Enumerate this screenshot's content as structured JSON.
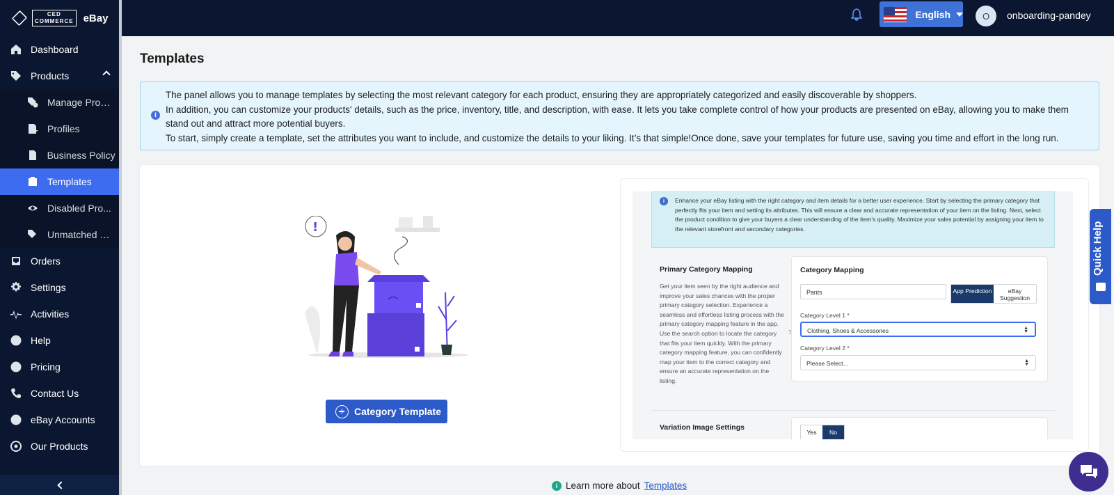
{
  "brand": {
    "logo_line1": "CED",
    "logo_line2": "COMMERCE",
    "product": "eBay"
  },
  "sidebar": {
    "items": [
      {
        "label": "Dashboard",
        "icon": "home-icon"
      },
      {
        "label": "Products",
        "icon": "tag-icon"
      },
      {
        "label": "Manage Prod...",
        "icon": "gear-tag-icon"
      },
      {
        "label": "Profiles",
        "icon": "profile-doc-icon"
      },
      {
        "label": "Business Policy",
        "icon": "document-icon"
      },
      {
        "label": "Templates",
        "icon": "template-icon"
      },
      {
        "label": "Disabled Pro...",
        "icon": "eye-off-icon"
      },
      {
        "label": "Unmatched Pr...",
        "icon": "tag-x-icon"
      },
      {
        "label": "Orders",
        "icon": "inbox-icon"
      },
      {
        "label": "Settings",
        "icon": "gear-icon"
      },
      {
        "label": "Activities",
        "icon": "activity-icon"
      },
      {
        "label": "Help",
        "icon": "help-icon"
      },
      {
        "label": "Pricing",
        "icon": "dollar-icon"
      },
      {
        "label": "Contact Us",
        "icon": "phone-icon"
      },
      {
        "label": "eBay Accounts",
        "icon": "user-icon"
      },
      {
        "label": "Our Products",
        "icon": "globe-icon"
      }
    ]
  },
  "topbar": {
    "language": "English",
    "avatar_initial": "O",
    "username": "onboarding-pandey"
  },
  "page": {
    "title": "Templates",
    "info_line1": "The panel allows you to manage templates by selecting the most relevant category for each product, ensuring they are appropriately categorized and easily discoverable by shoppers.",
    "info_line2": "In addition, you can customize your products' details, such as the price, inventory, title, and description, with ease. It lets you take complete control of how your products are presented on eBay, allowing you to make them stand out and attract more potential buyers.",
    "info_line3": "To start, simply create a template, set the attributes you want to include, and customize the details to your liking. It’s that simple!Once done, save your templates for future use, saving you time and effort in the long run.",
    "category_template_button": "Category Template"
  },
  "preview": {
    "info": "Enhance your eBay listing with the right category and item details for a better user experience. Start by selecting the primary category that perfectly fits your item and setting its attributes. This will ensure a clear and accurate representation of your item on the listing. Next, select the product condition to give your buyers a clear understanding of the item's quality. Maximize your sales potential by assigning your item to the relevant storefront and secondary categories.",
    "primary_title": "Primary Category Mapping",
    "primary_desc": "Get your item seen by the right audience and improve your sales chances with the proper primary category selection. Experience a seamless and effortless listing process with the primary category mapping feature in the app. Use the search option to locate the category that fits your item quickly. With the primary category mapping feature, you can confidently map your item to the correct category and ensure an accurate representation on the listing.",
    "mapping_title": "Category Mapping",
    "search_value": "Pants",
    "app_prediction": "App Prediction",
    "ebay_suggestion": "eBay Suggestion",
    "level1_label": "Category Level 1 *",
    "level1_value": "Clothing, Shoes & Accessories",
    "level2_label": "Category Level 2 *",
    "level2_value": "Please Select...",
    "variation_title": "Variation Image Settings",
    "yes": "Yes",
    "no": "No"
  },
  "quick_help": "Quick Help",
  "footer": {
    "learn_prefix": "Learn more about",
    "learn_link": "Templates"
  },
  "colors": {
    "sidebar_bg": "#0b1731",
    "accent": "#3d6cf0",
    "button": "#2c5ac9",
    "info_bg": "#e4f5fd"
  }
}
